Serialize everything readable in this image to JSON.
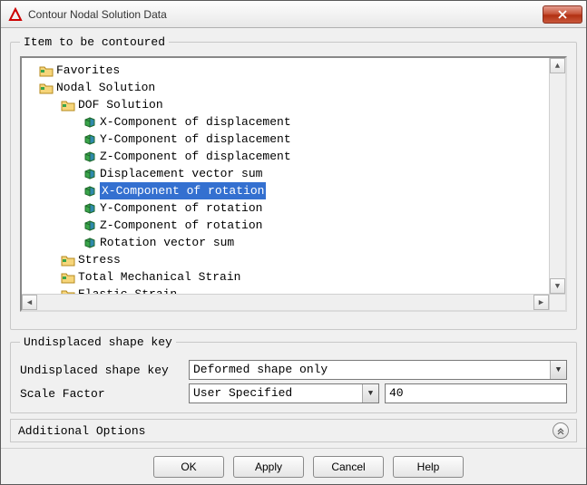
{
  "window": {
    "title": "Contour Nodal Solution Data"
  },
  "groups": {
    "tree_legend": "Item to be contoured",
    "shape_legend": "Undisplaced shape key"
  },
  "tree": {
    "items": [
      {
        "label": "Favorites",
        "depth": 0,
        "icon": "folder"
      },
      {
        "label": "Nodal Solution",
        "depth": 0,
        "icon": "folder-open"
      },
      {
        "label": "DOF Solution",
        "depth": 1,
        "icon": "folder-open"
      },
      {
        "label": "X-Component of displacement",
        "depth": 2,
        "icon": "cube"
      },
      {
        "label": "Y-Component of displacement",
        "depth": 2,
        "icon": "cube"
      },
      {
        "label": "Z-Component of displacement",
        "depth": 2,
        "icon": "cube"
      },
      {
        "label": "Displacement vector sum",
        "depth": 2,
        "icon": "cube"
      },
      {
        "label": "X-Component of rotation",
        "depth": 2,
        "icon": "cube",
        "selected": true
      },
      {
        "label": "Y-Component of rotation",
        "depth": 2,
        "icon": "cube"
      },
      {
        "label": "Z-Component of rotation",
        "depth": 2,
        "icon": "cube"
      },
      {
        "label": "Rotation vector sum",
        "depth": 2,
        "icon": "cube"
      },
      {
        "label": "Stress",
        "depth": 1,
        "icon": "folder"
      },
      {
        "label": "Total Mechanical Strain",
        "depth": 1,
        "icon": "folder"
      },
      {
        "label": "Elastic Strain",
        "depth": 1,
        "icon": "folder"
      }
    ]
  },
  "shape": {
    "label_key": "Undisplaced shape key",
    "value_key": "Deformed shape only",
    "label_scale": "Scale Factor",
    "value_scale": "User Specified",
    "scale_number": "40"
  },
  "additional": {
    "label": "Additional Options"
  },
  "buttons": {
    "ok": "OK",
    "apply": "Apply",
    "cancel": "Cancel",
    "help": "Help"
  }
}
